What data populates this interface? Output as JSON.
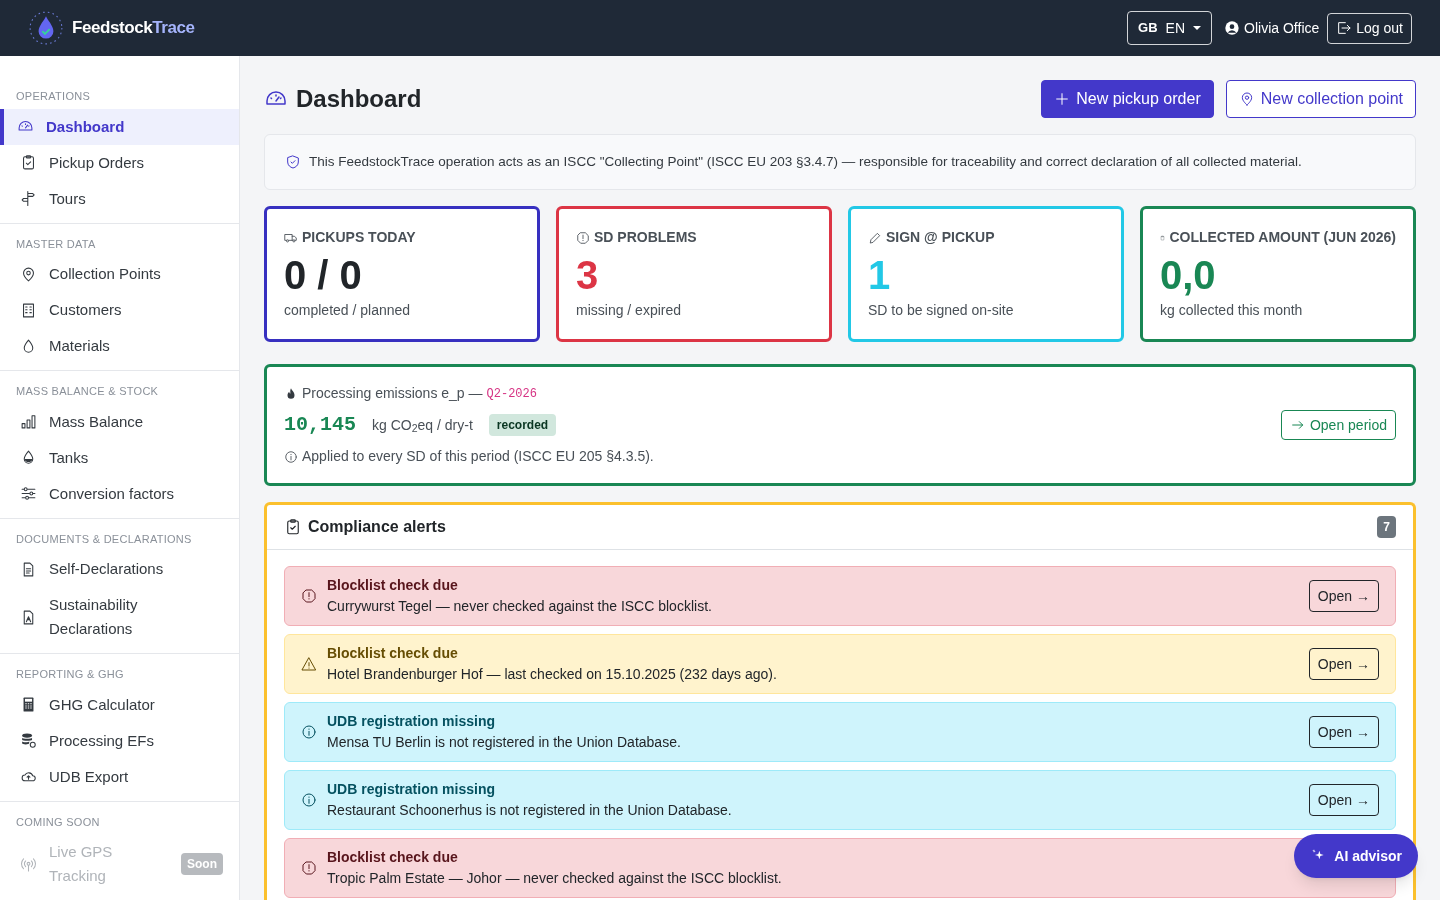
{
  "header": {
    "brand": {
      "part_1": "Feedstock",
      "part_2": "Trace"
    },
    "language": {
      "flag": "GB",
      "code": "EN"
    },
    "user": "Olivia Office",
    "logout": "Log out"
  },
  "sidebar": {
    "sections": [
      {
        "title": "OPERATIONS",
        "items": [
          {
            "label": "Dashboard",
            "selected": true,
            "disabled": false
          },
          {
            "label": "Pickup Orders",
            "selected": false,
            "disabled": false
          },
          {
            "label": "Tours",
            "selected": false,
            "disabled": false
          }
        ]
      },
      {
        "title": "MASTER DATA",
        "items": [
          {
            "label": "Collection Points",
            "selected": false,
            "disabled": false
          },
          {
            "label": "Customers",
            "selected": false,
            "disabled": false
          },
          {
            "label": "Materials",
            "selected": false,
            "disabled": false
          }
        ]
      },
      {
        "title": "MASS BALANCE & STOCK",
        "items": [
          {
            "label": "Mass Balance",
            "selected": false,
            "disabled": false
          },
          {
            "label": "Tanks",
            "selected": false,
            "disabled": false
          },
          {
            "label": "Conversion factors",
            "selected": false,
            "disabled": false
          }
        ]
      },
      {
        "title": "DOCUMENTS & DECLARATIONS",
        "items": [
          {
            "label": "Self-Declarations",
            "selected": false,
            "disabled": false
          },
          {
            "label": "Sustainability Declarations",
            "selected": false,
            "disabled": false
          }
        ]
      },
      {
        "title": "REPORTING & GHG",
        "items": [
          {
            "label": "GHG Calculator",
            "selected": false,
            "disabled": false
          },
          {
            "label": "Processing EFs",
            "selected": false,
            "disabled": false
          },
          {
            "label": "UDB Export",
            "selected": false,
            "disabled": false
          }
        ]
      },
      {
        "title": "COMING SOON",
        "items": [
          {
            "label": "Live GPS Tracking",
            "selected": false,
            "disabled": true,
            "badge": "Soon"
          }
        ]
      }
    ]
  },
  "page": {
    "title": "Dashboard",
    "buttons": [
      {
        "label": "New pickup order",
        "kind": "solid"
      },
      {
        "label": "New collection point",
        "kind": "outline"
      }
    ],
    "notice": "This FeedstockTrace operation acts as an ISCC \"Collecting Point\" (ISCC EU 203 §3.4.7) — responsible for traceability and correct declaration of all collected material.",
    "stats": [
      {
        "title": "PICKUPS TODAY",
        "value": "0 / 0",
        "caption": "completed / planned",
        "kind": "primary"
      },
      {
        "title": "SD PROBLEMS",
        "value": "3",
        "caption": "missing / expired",
        "kind": "danger"
      },
      {
        "title": "SIGN @ PICKUP",
        "value": "1",
        "caption": "SD to be signed on-site",
        "kind": "info"
      },
      {
        "title": "COLLECTED AMOUNT (JUN 2026)",
        "value": "0,0",
        "caption": "kg collected this month",
        "kind": "success"
      }
    ],
    "emissions": {
      "label": "Processing emissions e_p —",
      "period": "Q2-2026",
      "value": "10,145",
      "unit": "kg CO$_{2}$eq / dry-t",
      "badge": "recorded",
      "note": "Applied to every SD of this period (ISCC EU 205 §4.3.5).",
      "button": "Open period"
    },
    "alerts": {
      "title": "Compliance alerts",
      "count": "7",
      "items": [
        {
          "kind": "danger",
          "title": "Blocklist check due",
          "text": "Currywurst Tegel — never checked against the ISCC blocklist.",
          "action": "Open →"
        },
        {
          "kind": "warning",
          "title": "Blocklist check due",
          "text": "Hotel Brandenburger Hof — last checked on 15.10.2025 (232 days ago).",
          "action": "Open →"
        },
        {
          "kind": "info",
          "title": "UDB registration missing",
          "text": "Mensa TU Berlin is not registered in the Union Database.",
          "action": "Open →"
        },
        {
          "kind": "info",
          "title": "UDB registration missing",
          "text": "Restaurant Schoonerhus is not registered in the Union Database.",
          "action": "Open →"
        },
        {
          "kind": "danger",
          "title": "Blocklist check due",
          "text": "Tropic Palm Estate — Johor — never checked against the ISCC blocklist."
        }
      ]
    }
  },
  "assistant": {
    "label": "AI advisor"
  }
}
